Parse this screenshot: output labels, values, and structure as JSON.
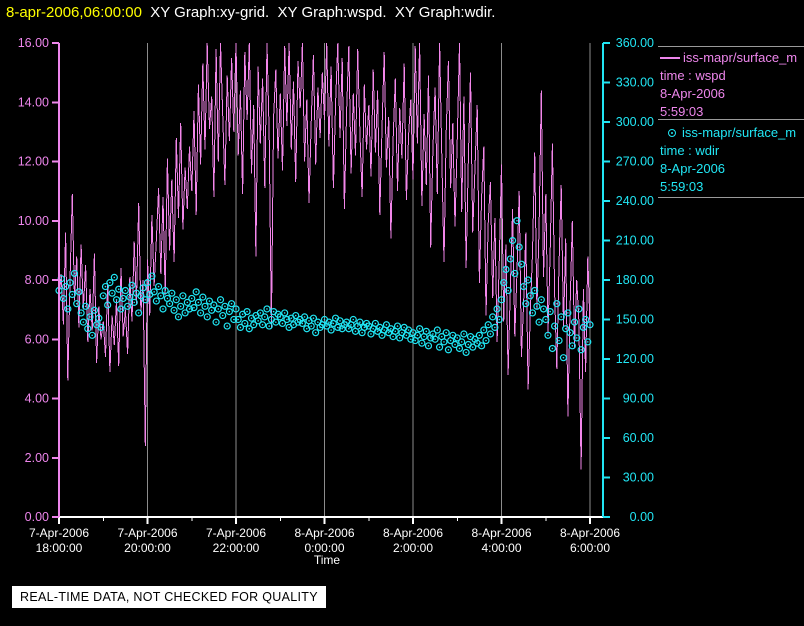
{
  "titlebar": {
    "timestamp": "8-apr-2006,06:00:00",
    "graphs": "  XY Graph:xy-grid.  XY Graph:wspd.  XY Graph:wdir."
  },
  "legend": {
    "entries": [
      {
        "symbol": "line-swatch",
        "color": "#ee86ec",
        "name": "iss-mapr/surface_m",
        "field": "time : wspd",
        "date": "8-Apr-2006",
        "clock": "5:59:03"
      },
      {
        "symbol": "circle-marker",
        "color": "#21e6f4",
        "name": "iss-mapr/surface_m",
        "field": "time : wdir",
        "date": "8-Apr-2006",
        "clock": "5:59:03"
      }
    ]
  },
  "notice": {
    "text": "REAL-TIME DATA, NOT CHECKED FOR QUALITY"
  },
  "chart_data": {
    "type": "line+scatter",
    "title": "",
    "xlabel": "Time",
    "grid": "vertical-only",
    "x_axis": {
      "unit": "hours after 7-Apr-2006 18:00:00",
      "range": [
        0,
        12.3
      ],
      "axis_color": "#ffffff",
      "grid_color": "#8c8c8c",
      "major_tick_hours": [
        0,
        2,
        4,
        6,
        8,
        10,
        12
      ],
      "minor_tick_hours": [
        1,
        3,
        5,
        7,
        9,
        11
      ],
      "grid_hours": [
        2,
        4,
        6,
        8,
        10,
        12
      ],
      "tick_labels": [
        {
          "date": "7-Apr-2006",
          "time": "18:00:00"
        },
        {
          "date": "7-Apr-2006",
          "time": "20:00:00"
        },
        {
          "date": "7-Apr-2006",
          "time": "22:00:00"
        },
        {
          "date": "8-Apr-2006",
          "time": "0:00:00"
        },
        {
          "date": "8-Apr-2006",
          "time": "2:00:00"
        },
        {
          "date": "8-Apr-2006",
          "time": "4:00:00"
        },
        {
          "date": "8-Apr-2006",
          "time": "6:00:00"
        }
      ]
    },
    "left_axis": {
      "name": "wspd",
      "range": [
        0,
        16
      ],
      "tick_step": 2,
      "color": "#ee86ec",
      "tick_labels": [
        "0.00",
        "2.00",
        "4.00",
        "6.00",
        "8.00",
        "10.00",
        "12.00",
        "14.00",
        "16.00"
      ]
    },
    "right_axis": {
      "name": "wdir",
      "range": [
        0,
        360
      ],
      "tick_step": 30,
      "color": "#21e6f4",
      "tick_labels": [
        "0.00",
        "30.00",
        "60.00",
        "90.00",
        "120.00",
        "150.00",
        "180.00",
        "210.00",
        "240.00",
        "270.00",
        "300.00",
        "330.00",
        "360.00"
      ]
    },
    "series": [
      {
        "name": "wspd",
        "type": "line",
        "axis": "left",
        "color": "#f286ea",
        "x_start": 0,
        "x_step": 0.05,
        "values": [
          7.4,
          8.2,
          6.5,
          9.6,
          4.6,
          8.1,
          10.9,
          7.3,
          8.8,
          6.4,
          9.2,
          7.0,
          8.5,
          5.9,
          7.7,
          6.3,
          8.9,
          5.2,
          7.1,
          6.0,
          6.6,
          5.4,
          7.9,
          4.9,
          6.8,
          5.8,
          7.3,
          5.1,
          8.4,
          6.1,
          7.0,
          5.5,
          8.1,
          6.6,
          9.3,
          7.2,
          10.6,
          6.9,
          8.0,
          2.4,
          8.7,
          6.8,
          10.2,
          7.8,
          9.4,
          11.1,
          8.2,
          10.8,
          7.5,
          12.1,
          9.0,
          11.4,
          8.6,
          12.8,
          10.1,
          13.3,
          9.7,
          11.8,
          10.4,
          12.5,
          11.0,
          13.7,
          10.2,
          14.6,
          11.9,
          15.3,
          12.4,
          16.0,
          13.1,
          14.2,
          10.8,
          15.8,
          12.0,
          16.0,
          13.6,
          11.2,
          14.9,
          12.7,
          15.5,
          13.0,
          16.0,
          12.2,
          14.4,
          10.9,
          15.7,
          13.4,
          16.0,
          11.6,
          13.9,
          8.8,
          15.2,
          12.6,
          14.8,
          11.1,
          16.0,
          12.9,
          6.4,
          13.5,
          15.1,
          12.1,
          14.3,
          11.7,
          15.9,
          13.2,
          16.0,
          12.4,
          14.7,
          11.3,
          15.4,
          13.8,
          16.0,
          12.0,
          14.1,
          10.6,
          13.3,
          15.6,
          11.9,
          14.5,
          12.8,
          15.0,
          13.4,
          16.0,
          12.5,
          15.2,
          11.1,
          14.0,
          16.0,
          12.8,
          15.5,
          10.4,
          13.7,
          15.9,
          11.6,
          14.3,
          12.2,
          15.8,
          13.0,
          10.8,
          14.6,
          12.4,
          13.9,
          11.5,
          15.1,
          12.3,
          14.4,
          10.2,
          13.1,
          15.7,
          11.8,
          13.5,
          9.4,
          12.7,
          14.8,
          11.0,
          13.8,
          12.1,
          15.3,
          10.7,
          12.9,
          14.1,
          11.4,
          15.9,
          12.6,
          16.0,
          10.5,
          13.6,
          11.2,
          14.9,
          9.1,
          12.4,
          14.5,
          10.9,
          16.0,
          12.2,
          8.6,
          13.0,
          15.4,
          11.1,
          13.3,
          9.8,
          12.8,
          16.0,
          10.3,
          14.2,
          8.4,
          12.0,
          15.0,
          9.6,
          11.7,
          13.9,
          7.9,
          10.8,
          12.5,
          6.8,
          9.9,
          11.3,
          7.4,
          10.1,
          5.9,
          8.7,
          11.9,
          6.6,
          9.2,
          4.8,
          7.8,
          10.4,
          6.1,
          8.3,
          11.0,
          5.4,
          7.2,
          9.6,
          4.3,
          6.9,
          8.9,
          12.3,
          7.0,
          9.8,
          14.4,
          8.1,
          10.9,
          6.2,
          9.0,
          12.6,
          7.6,
          5.0,
          8.5,
          11.2,
          6.4,
          9.4,
          3.4,
          7.1,
          10.0,
          5.7,
          8.0,
          6.6,
          1.6,
          7.7,
          4.9,
          8.8,
          6.4
        ]
      },
      {
        "name": "wdir",
        "type": "scatter",
        "axis": "right",
        "color": "#21e6f4",
        "x_start": 0,
        "x_step": 0.05,
        "values": [
          172,
          181,
          166,
          175,
          158,
          178,
          169,
          185,
          162,
          171,
          155,
          148,
          160,
          143,
          152,
          138,
          157,
          146,
          151,
          144,
          168,
          175,
          161,
          178,
          170,
          182,
          165,
          173,
          158,
          166,
          172,
          160,
          167,
          176,
          163,
          170,
          155,
          168,
          174,
          165,
          178,
          169,
          183,
          171,
          164,
          175,
          168,
          158,
          172,
          166,
          162,
          170,
          157,
          165,
          152,
          160,
          168,
          155,
          163,
          158,
          166,
          159,
          171,
          163,
          155,
          167,
          160,
          152,
          164,
          157,
          161,
          148,
          158,
          165,
          153,
          160,
          145,
          156,
          162,
          150,
          158,
          150,
          144,
          154,
          147,
          156,
          143,
          151,
          146,
          153,
          149,
          155,
          146,
          152,
          158,
          145,
          150,
          156,
          148,
          154,
          152,
          147,
          155,
          150,
          144,
          151,
          146,
          153,
          148,
          150,
          147,
          152,
          143,
          149,
          145,
          151,
          140,
          148,
          144,
          146,
          150,
          145,
          148,
          142,
          147,
          151,
          144,
          149,
          143,
          146,
          148,
          143,
          146,
          150,
          141,
          145,
          148,
          140,
          144,
          147,
          145,
          139,
          143,
          147,
          141,
          144,
          138,
          142,
          146,
          140,
          143,
          137,
          141,
          145,
          136,
          140,
          144,
          138,
          142,
          135,
          140,
          134,
          138,
          143,
          132,
          137,
          141,
          130,
          136,
          139,
          135,
          142,
          129,
          137,
          133,
          140,
          127,
          134,
          138,
          131,
          136,
          128,
          133,
          139,
          125,
          131,
          137,
          129,
          135,
          132,
          138,
          130,
          142,
          134,
          146,
          139,
          152,
          144,
          158,
          150,
          165,
          178,
          188,
          172,
          196,
          210,
          185,
          225,
          205,
          192,
          175,
          162,
          180,
          168,
          155,
          172,
          160,
          148,
          165,
          158,
          150,
          138,
          156,
          128,
          145,
          162,
          134,
          152,
          121,
          143,
          155,
          140,
          130,
          148,
          136,
          158,
          127,
          144,
          150,
          133,
          146
        ]
      }
    ]
  }
}
